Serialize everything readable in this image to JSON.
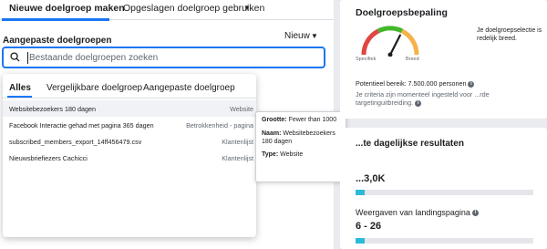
{
  "tabs": {
    "new": "Nieuwe doelgroep maken",
    "saved": "Opgeslagen doelgroep gebruiken"
  },
  "section_label": "Aangepaste doelgroepen",
  "sort_label": "Nieuw",
  "search": {
    "placeholder": "Bestaande doelgroepen zoeken"
  },
  "dropdown": {
    "tabs": [
      "Alles",
      "Vergelijkbare doelgroep",
      "Aangepaste doelgroep"
    ],
    "rows": [
      {
        "name": "Websitebezoekers 180 dagen",
        "type": "Website"
      },
      {
        "name": "Facebook Interactie gehad met pagina 365 dagen",
        "type": "Betrokkenheid - pagina"
      },
      {
        "name": "subscribed_members_export_14ff456479.csv",
        "type": "Klantenlijst"
      },
      {
        "name": "Nieuwsbriefiezers Cachicci",
        "type": "Klantenlijst"
      }
    ]
  },
  "tooltip": {
    "size_key": "Grootte:",
    "size_val": "Fewer than 1000",
    "name_key": "Naam:",
    "name_val": "Websitebezoekers 180 dagen",
    "type_key": "Type:",
    "type_val": "Website"
  },
  "audience_def": {
    "title": "Doelgroepsbepaling",
    "gauge_left": "Specifiek",
    "gauge_right": "Breed",
    "description": "Je doelgroepselectie is redelijk breed.",
    "potential_reach": "Potentieel bereik: 7.500.000 personen",
    "criteria_note": "Je criteria zijn momenteel ingesteld voor ...rde targetinguitbreiding.",
    "gauge_level": 0.65
  },
  "daily_results": {
    "title": "...te dagelijkse resultaten",
    "metric1_value": "...3,0K",
    "metric1_fill": 0.05,
    "metric2_label": "Weergaven van landingspagina",
    "metric2_value": "6 - 26",
    "metric2_fill": 0.05
  },
  "colors": {
    "accent": "#1877f2",
    "bar": "#2abbd8"
  }
}
